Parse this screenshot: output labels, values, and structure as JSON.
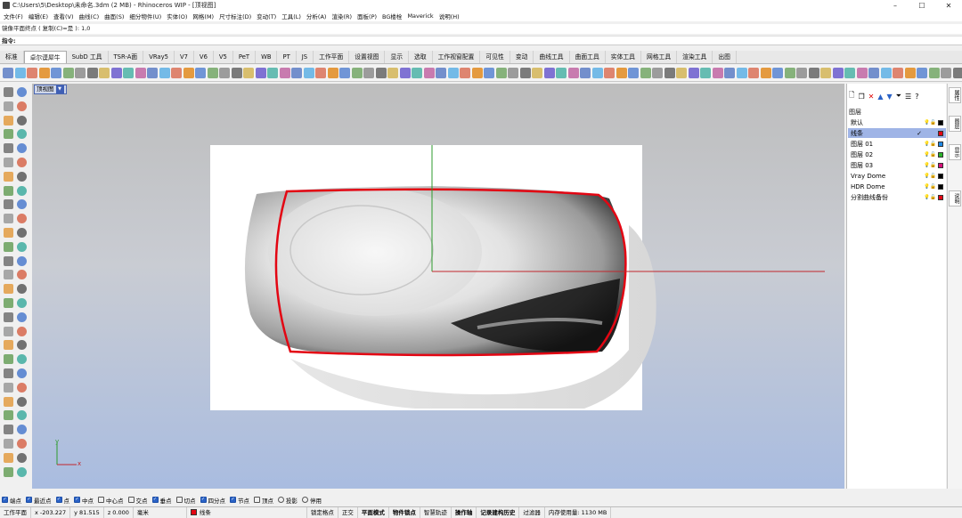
{
  "window": {
    "title": "C:\\Users\\5\\Desktop\\未命名.3dm (2 MB) - Rhinoceros WIP - [顶视图]",
    "controls": [
      "–",
      "☐",
      "✕"
    ]
  },
  "menu": [
    "文件(F)",
    "编辑(E)",
    "查看(V)",
    "曲线(C)",
    "曲面(S)",
    "细分物件(U)",
    "实体(O)",
    "网格(M)",
    "尺寸标注(D)",
    "变动(T)",
    "工具(L)",
    "分析(A)",
    "渲染(R)",
    "面板(P)",
    "BG楼栓",
    "Maverick",
    "说明(H)"
  ],
  "command": {
    "history": "镜像平面终点 ( 复制(C)=是 ): 1,0",
    "prompt": "指令:"
  },
  "tabs": [
    "标准",
    "卓尔谟犀牛",
    "SubD 工具",
    "TSR-A面",
    "VRay5",
    "V7",
    "V6",
    "V5",
    "PeT",
    "WB",
    "PT",
    "JS",
    "工作平面",
    "设置视图",
    "显示",
    "选取",
    "工作视窗配置",
    "可见性",
    "变动",
    "曲线工具",
    "曲面工具",
    "实体工具",
    "网格工具",
    "渲染工具",
    "出图"
  ],
  "active_tab_index": 1,
  "viewport": {
    "label": "顶视图",
    "axis_x": "x",
    "axis_y": "y"
  },
  "layers": {
    "header": "图层",
    "items": [
      {
        "name": "默认",
        "color": "#000000",
        "selected": false,
        "current": false
      },
      {
        "name": "线条",
        "color": "#e30613",
        "selected": true,
        "current": true
      },
      {
        "name": "图层 01",
        "color": "#1e88e5",
        "selected": false,
        "current": false
      },
      {
        "name": "图层 02",
        "color": "#2bb32b",
        "selected": false,
        "current": false
      },
      {
        "name": "图层 03",
        "color": "#d6127a",
        "selected": false,
        "current": false
      },
      {
        "name": "Vray Dome",
        "color": "#000000",
        "selected": false,
        "current": false
      },
      {
        "name": "HDR Dome",
        "color": "#000000",
        "selected": false,
        "current": false
      },
      {
        "name": "分割曲线备份",
        "color": "#e30613",
        "selected": false,
        "current": false
      }
    ],
    "check_mark": "✓"
  },
  "side_tabs": [
    "属性",
    "图层",
    "显示",
    "说明"
  ],
  "osnaps": [
    {
      "label": "端点",
      "checked": true
    },
    {
      "label": "最近点",
      "checked": true
    },
    {
      "label": "点",
      "checked": true
    },
    {
      "label": "中点",
      "checked": true
    },
    {
      "label": "中心点",
      "checked": false
    },
    {
      "label": "交点",
      "checked": false
    },
    {
      "label": "垂点",
      "checked": true
    },
    {
      "label": "切点",
      "checked": false
    },
    {
      "label": "四分点",
      "checked": true
    },
    {
      "label": "节点",
      "checked": true
    },
    {
      "label": "顶点",
      "checked": false
    },
    {
      "label": "投影",
      "checked": false,
      "radio": true
    },
    {
      "label": "停用",
      "checked": false,
      "radio": true
    }
  ],
  "status": {
    "cplane": "工作平面",
    "x": "x -203.227",
    "y": "y 81.515",
    "z": "z 0.000",
    "units": "毫米",
    "layer": "线条",
    "layer_color": "#e30613",
    "toggles": [
      "锁定格点",
      "正交",
      "平面模式",
      "物件锁点",
      "智慧轨迹",
      "操作轴",
      "记录建构历史",
      "过滤器"
    ],
    "bold_toggles": [
      "平面模式",
      "物件锁点",
      "操作轴",
      "记录建构历史"
    ],
    "memory": "内存使用量: 1130 MB"
  }
}
